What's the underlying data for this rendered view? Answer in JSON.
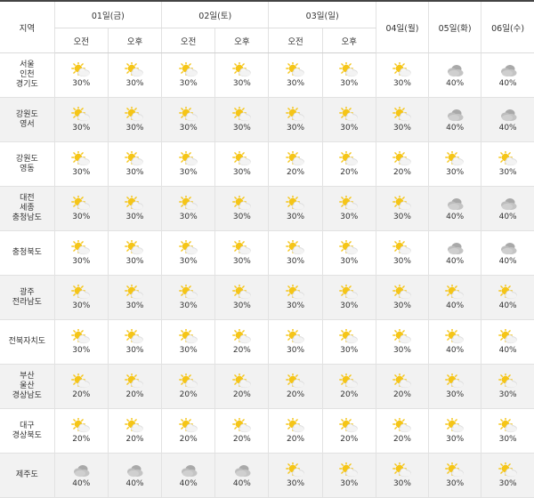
{
  "header": {
    "region_label": "지역",
    "days": [
      {
        "label": "01일(금)",
        "slots": [
          "오전",
          "오후"
        ]
      },
      {
        "label": "02일(토)",
        "slots": [
          "오전",
          "오후"
        ]
      },
      {
        "label": "03일(일)",
        "slots": [
          "오전",
          "오후"
        ]
      },
      {
        "label": "04일(월)",
        "slots": []
      },
      {
        "label": "05일(화)",
        "slots": []
      },
      {
        "label": "06일(수)",
        "slots": []
      }
    ]
  },
  "colors": {
    "sun": "#f5c517",
    "cloud_light": "#eeeeee",
    "cloud_dark": "#a9a9a9",
    "row_alt": "#f2f2f2",
    "header_line": "#444444"
  },
  "rows": [
    {
      "region": [
        "서울",
        "인천",
        "경기도"
      ],
      "cells": [
        {
          "icon": "partly-cloudy-icon",
          "pct": "30%"
        },
        {
          "icon": "partly-cloudy-icon",
          "pct": "30%"
        },
        {
          "icon": "partly-cloudy-icon",
          "pct": "30%"
        },
        {
          "icon": "partly-cloudy-icon",
          "pct": "30%"
        },
        {
          "icon": "partly-cloudy-icon",
          "pct": "30%"
        },
        {
          "icon": "partly-cloudy-icon",
          "pct": "30%"
        },
        {
          "icon": "partly-cloudy-icon",
          "pct": "30%"
        },
        {
          "icon": "cloudy-icon",
          "pct": "40%"
        },
        {
          "icon": "cloudy-icon",
          "pct": "40%"
        }
      ]
    },
    {
      "region": [
        "강원도",
        "영서"
      ],
      "cells": [
        {
          "icon": "partly-cloudy-icon",
          "pct": "30%"
        },
        {
          "icon": "partly-cloudy-icon",
          "pct": "30%"
        },
        {
          "icon": "partly-cloudy-icon",
          "pct": "30%"
        },
        {
          "icon": "partly-cloudy-icon",
          "pct": "30%"
        },
        {
          "icon": "partly-cloudy-icon",
          "pct": "30%"
        },
        {
          "icon": "partly-cloudy-icon",
          "pct": "30%"
        },
        {
          "icon": "partly-cloudy-icon",
          "pct": "30%"
        },
        {
          "icon": "cloudy-icon",
          "pct": "40%"
        },
        {
          "icon": "cloudy-icon",
          "pct": "40%"
        }
      ]
    },
    {
      "region": [
        "강원도",
        "영동"
      ],
      "cells": [
        {
          "icon": "partly-cloudy-icon",
          "pct": "30%"
        },
        {
          "icon": "partly-cloudy-icon",
          "pct": "30%"
        },
        {
          "icon": "partly-cloudy-icon",
          "pct": "30%"
        },
        {
          "icon": "partly-cloudy-icon",
          "pct": "30%"
        },
        {
          "icon": "partly-cloudy-icon",
          "pct": "20%"
        },
        {
          "icon": "partly-cloudy-icon",
          "pct": "20%"
        },
        {
          "icon": "partly-cloudy-icon",
          "pct": "20%"
        },
        {
          "icon": "partly-cloudy-icon",
          "pct": "30%"
        },
        {
          "icon": "partly-cloudy-icon",
          "pct": "30%"
        }
      ]
    },
    {
      "region": [
        "대전",
        "세종",
        "충청남도"
      ],
      "cells": [
        {
          "icon": "partly-cloudy-icon",
          "pct": "30%"
        },
        {
          "icon": "partly-cloudy-icon",
          "pct": "30%"
        },
        {
          "icon": "partly-cloudy-icon",
          "pct": "30%"
        },
        {
          "icon": "partly-cloudy-icon",
          "pct": "30%"
        },
        {
          "icon": "partly-cloudy-icon",
          "pct": "30%"
        },
        {
          "icon": "partly-cloudy-icon",
          "pct": "30%"
        },
        {
          "icon": "partly-cloudy-icon",
          "pct": "30%"
        },
        {
          "icon": "cloudy-icon",
          "pct": "40%"
        },
        {
          "icon": "cloudy-icon",
          "pct": "40%"
        }
      ]
    },
    {
      "region": [
        "충청북도"
      ],
      "cells": [
        {
          "icon": "partly-cloudy-icon",
          "pct": "30%"
        },
        {
          "icon": "partly-cloudy-icon",
          "pct": "30%"
        },
        {
          "icon": "partly-cloudy-icon",
          "pct": "30%"
        },
        {
          "icon": "partly-cloudy-icon",
          "pct": "30%"
        },
        {
          "icon": "partly-cloudy-icon",
          "pct": "30%"
        },
        {
          "icon": "partly-cloudy-icon",
          "pct": "30%"
        },
        {
          "icon": "partly-cloudy-icon",
          "pct": "30%"
        },
        {
          "icon": "cloudy-icon",
          "pct": "40%"
        },
        {
          "icon": "cloudy-icon",
          "pct": "40%"
        }
      ]
    },
    {
      "region": [
        "광주",
        "전라남도"
      ],
      "cells": [
        {
          "icon": "partly-cloudy-icon",
          "pct": "30%"
        },
        {
          "icon": "partly-cloudy-icon",
          "pct": "30%"
        },
        {
          "icon": "partly-cloudy-icon",
          "pct": "30%"
        },
        {
          "icon": "partly-cloudy-icon",
          "pct": "30%"
        },
        {
          "icon": "partly-cloudy-icon",
          "pct": "30%"
        },
        {
          "icon": "partly-cloudy-icon",
          "pct": "30%"
        },
        {
          "icon": "partly-cloudy-icon",
          "pct": "30%"
        },
        {
          "icon": "partly-cloudy-icon",
          "pct": "40%"
        },
        {
          "icon": "partly-cloudy-icon",
          "pct": "40%"
        }
      ]
    },
    {
      "region": [
        "전북자치도"
      ],
      "cells": [
        {
          "icon": "partly-cloudy-icon",
          "pct": "30%"
        },
        {
          "icon": "partly-cloudy-icon",
          "pct": "30%"
        },
        {
          "icon": "partly-cloudy-icon",
          "pct": "30%"
        },
        {
          "icon": "partly-cloudy-icon",
          "pct": "20%"
        },
        {
          "icon": "partly-cloudy-icon",
          "pct": "30%"
        },
        {
          "icon": "partly-cloudy-icon",
          "pct": "30%"
        },
        {
          "icon": "partly-cloudy-icon",
          "pct": "30%"
        },
        {
          "icon": "partly-cloudy-icon",
          "pct": "40%"
        },
        {
          "icon": "partly-cloudy-icon",
          "pct": "40%"
        }
      ]
    },
    {
      "region": [
        "부산",
        "울산",
        "경상남도"
      ],
      "cells": [
        {
          "icon": "partly-cloudy-icon",
          "pct": "20%"
        },
        {
          "icon": "partly-cloudy-icon",
          "pct": "20%"
        },
        {
          "icon": "partly-cloudy-icon",
          "pct": "20%"
        },
        {
          "icon": "partly-cloudy-icon",
          "pct": "20%"
        },
        {
          "icon": "partly-cloudy-icon",
          "pct": "20%"
        },
        {
          "icon": "partly-cloudy-icon",
          "pct": "20%"
        },
        {
          "icon": "partly-cloudy-icon",
          "pct": "20%"
        },
        {
          "icon": "partly-cloudy-icon",
          "pct": "30%"
        },
        {
          "icon": "partly-cloudy-icon",
          "pct": "30%"
        }
      ]
    },
    {
      "region": [
        "대구",
        "경상북도"
      ],
      "cells": [
        {
          "icon": "partly-cloudy-icon",
          "pct": "20%"
        },
        {
          "icon": "partly-cloudy-icon",
          "pct": "20%"
        },
        {
          "icon": "partly-cloudy-icon",
          "pct": "20%"
        },
        {
          "icon": "partly-cloudy-icon",
          "pct": "20%"
        },
        {
          "icon": "partly-cloudy-icon",
          "pct": "20%"
        },
        {
          "icon": "partly-cloudy-icon",
          "pct": "20%"
        },
        {
          "icon": "partly-cloudy-icon",
          "pct": "20%"
        },
        {
          "icon": "partly-cloudy-icon",
          "pct": "30%"
        },
        {
          "icon": "partly-cloudy-icon",
          "pct": "30%"
        }
      ]
    },
    {
      "region": [
        "제주도"
      ],
      "cells": [
        {
          "icon": "cloudy-icon",
          "pct": "40%"
        },
        {
          "icon": "cloudy-icon",
          "pct": "40%"
        },
        {
          "icon": "cloudy-icon",
          "pct": "40%"
        },
        {
          "icon": "cloudy-icon",
          "pct": "40%"
        },
        {
          "icon": "partly-cloudy-icon",
          "pct": "30%"
        },
        {
          "icon": "partly-cloudy-icon",
          "pct": "30%"
        },
        {
          "icon": "partly-cloudy-icon",
          "pct": "30%"
        },
        {
          "icon": "partly-cloudy-icon",
          "pct": "30%"
        },
        {
          "icon": "partly-cloudy-icon",
          "pct": "30%"
        }
      ]
    }
  ]
}
